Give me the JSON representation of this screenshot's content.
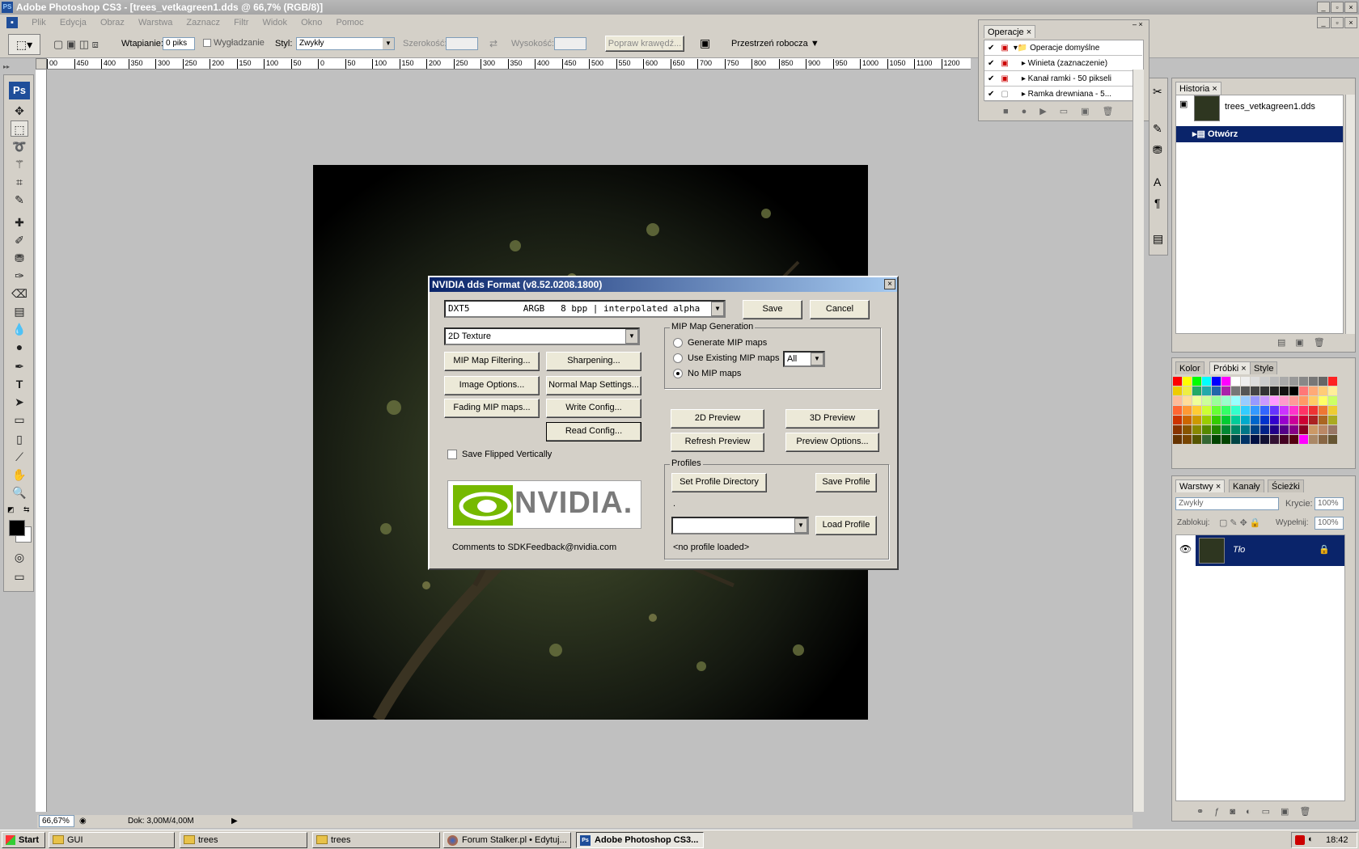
{
  "window": {
    "title": "Adobe Photoshop CS3 - [trees_vetkagreen1.dds @ 66,7% (RGB/8)]",
    "icon": "PS"
  },
  "menu": [
    "Plik",
    "Edycja",
    "Obraz",
    "Warstwa",
    "Zaznacz",
    "Filtr",
    "Widok",
    "Okno",
    "Pomoc"
  ],
  "options": {
    "feather_label": "Wtapianie:",
    "feather_value": "0 piks",
    "antialias_label": "Wygładzanie",
    "style_label": "Styl:",
    "style_value": "Zwykły",
    "width_label": "Szerokość:",
    "height_label": "Wysokość:",
    "refine_label": "Popraw krawędź...",
    "workspace_label": "Przestrzeń robocza"
  },
  "toolbox": {
    "logo": "Ps"
  },
  "ruler": [
    "00",
    "450",
    "400",
    "350",
    "300",
    "250",
    "200",
    "150",
    "100",
    "50",
    "0",
    "50",
    "100",
    "150",
    "200",
    "250",
    "300",
    "350",
    "400",
    "450",
    "500",
    "550",
    "600",
    "650",
    "700",
    "750",
    "800",
    "850",
    "900",
    "950",
    "1000",
    "1050",
    "1100",
    "1200"
  ],
  "dialog": {
    "title": "NVIDIA dds Format (v8.52.0208.1800)",
    "format": "DXT5          ARGB   8 bpp | interpolated alpha",
    "save": "Save",
    "cancel": "Cancel",
    "texture_type": "2D Texture",
    "mip_filtering": "MIP Map Filtering...",
    "sharpening": "Sharpening...",
    "image_options": "Image Options...",
    "normal_map": "Normal Map Settings...",
    "fading": "Fading MIP maps...",
    "write_config": "Write Config...",
    "read_config": "Read Config...",
    "save_flipped": "Save Flipped Vertically",
    "mip_group": "MIP Map Generation",
    "mip_generate": "Generate MIP maps",
    "mip_existing": "Use Existing MIP maps",
    "mip_existing_value": "All",
    "mip_none": "No MIP maps",
    "preview_2d": "2D Preview",
    "preview_3d": "3D Preview",
    "refresh": "Refresh Preview",
    "preview_options": "Preview Options...",
    "profiles_group": "Profiles",
    "set_profile_dir": "Set Profile Directory",
    "save_profile": "Save Profile",
    "profile_dot": ".",
    "load_profile": "Load Profile",
    "no_profile": "<no profile loaded>",
    "logo": "NVIDIA.",
    "comments": "Comments to SDKFeedback@nvidia.com"
  },
  "actions": {
    "tab": "Operacje",
    "rows": [
      "Operacje domyślne",
      "Winieta (zaznaczenie)",
      "Kanał ramki - 50 pikseli",
      "Ramka drewniana - 5..."
    ]
  },
  "history": {
    "tab": "Historia",
    "file": "trees_vetkagreen1.dds",
    "step": "Otwórz"
  },
  "swatch_panel": {
    "tabs": [
      "Kolor",
      "Próbki",
      "Style"
    ]
  },
  "layers": {
    "tabs": [
      "Warstwy",
      "Kanały",
      "Ścieżki"
    ],
    "blend": "Zwykły",
    "opacity_label": "Krycie:",
    "opacity": "100%",
    "lock_label": "Zablokuj:",
    "fill_label": "Wypełnij:",
    "fill": "100%",
    "layer": "Tło"
  },
  "status": {
    "zoom": "66,67%",
    "doc": "Dok: 3,00M/4,00M"
  },
  "taskbar": {
    "start": "Start",
    "items": [
      "GUI",
      "trees",
      "trees",
      "Forum Stalker.pl • Edytuj...",
      "Adobe Photoshop CS3..."
    ],
    "clock": "18:42"
  }
}
